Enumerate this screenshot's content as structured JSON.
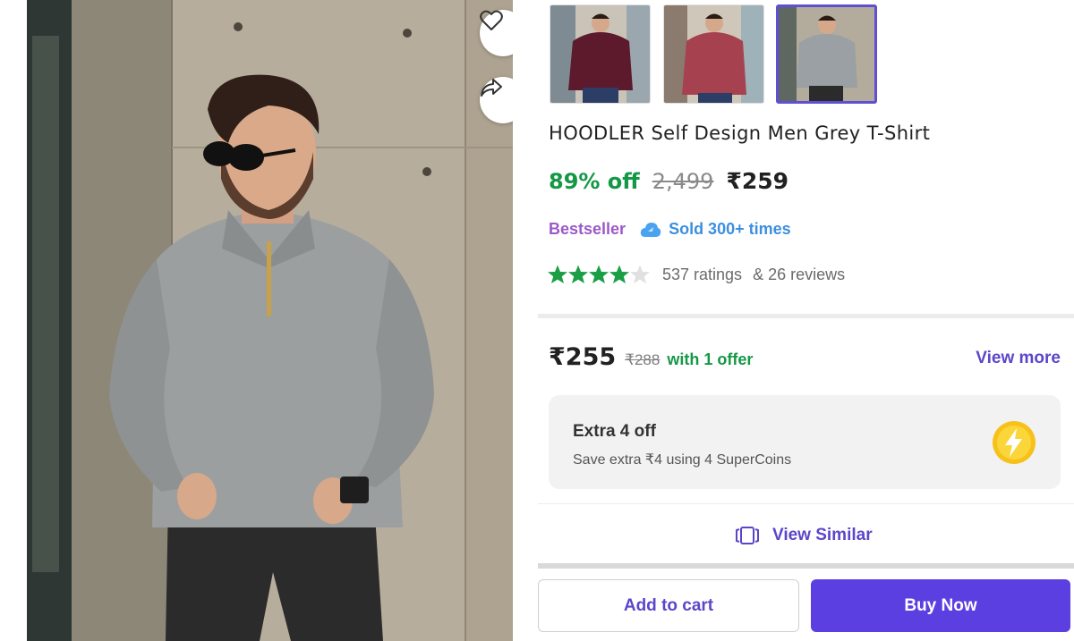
{
  "product": {
    "title": "HOODLER Self Design Men Grey T-Shirt",
    "discount": "89% off",
    "mrp": "2,499",
    "price": "₹259",
    "badge": "Bestseller",
    "sold": "Sold 300+ times",
    "rating_stars": 4,
    "rating_max": 5,
    "ratings_text": "537 ratings",
    "reviews_text": "& 26 reviews"
  },
  "thumbnails": [
    {
      "name": "maroon",
      "color": "#5c1a2c",
      "selected": false
    },
    {
      "name": "red-wine",
      "color": "#a6424f",
      "selected": false
    },
    {
      "name": "grey",
      "color": "#9aa0a3",
      "selected": true
    }
  ],
  "offer": {
    "price": "₹255",
    "mrp": "₹288",
    "text": "with 1 offer",
    "view_more": "View more"
  },
  "supercoins": {
    "title": "Extra 4 off",
    "subtitle": "Save extra ₹4 using 4 SuperCoins"
  },
  "view_similar": "View Similar",
  "actions": {
    "add_to_cart": "Add to cart",
    "buy_now": "Buy Now"
  },
  "icons": {
    "wishlist": "heart-icon",
    "share": "share-icon",
    "sold": "cloud-icon",
    "supercoin": "lightning-coin-icon",
    "similar": "view-similar-icon"
  },
  "colors": {
    "accent": "#5b3fe0",
    "discount_green": "#149846",
    "bestseller_purple": "#9b59c9",
    "sold_blue": "#3d8fe0",
    "star_green": "#1a9e46"
  }
}
